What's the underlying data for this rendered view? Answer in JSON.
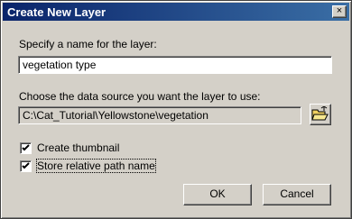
{
  "window": {
    "title": "Create New Layer",
    "close_glyph": "×"
  },
  "name_section": {
    "label": "Specify a name for the layer:",
    "value": "vegetation type"
  },
  "source_section": {
    "label": "Choose the data source you want the layer to use:",
    "value": "C:\\Cat_Tutorial\\Yellowstone\\vegetation",
    "browse_icon": "open-folder-icon"
  },
  "options": [
    {
      "label": "Create thumbnail",
      "checked": true
    },
    {
      "label": "Store relative path name",
      "checked": true
    }
  ],
  "buttons": {
    "ok": "OK",
    "cancel": "Cancel"
  },
  "colors": {
    "titlebar_start": "#0a246a",
    "titlebar_end": "#3a6ea5",
    "dialog_bg": "#d4d0c8"
  }
}
